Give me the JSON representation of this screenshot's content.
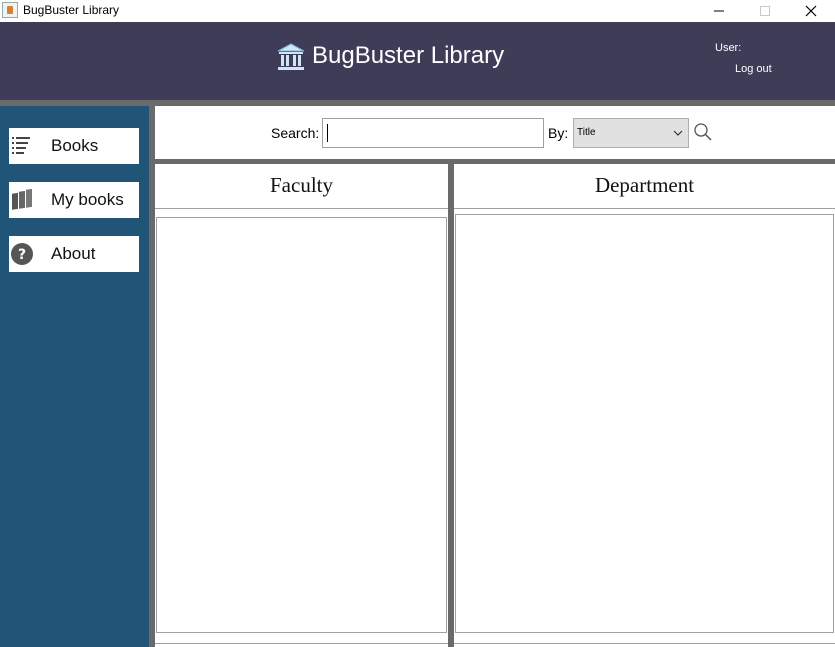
{
  "window": {
    "title": "BugBuster Library"
  },
  "header": {
    "title": "BugBuster Library",
    "user_label": "User:",
    "logout_label": "Log out",
    "background_color": "#3f3c57"
  },
  "sidebar": {
    "background_color": "#215577",
    "items": [
      {
        "label": "Books",
        "icon": "list-icon"
      },
      {
        "label": "My books",
        "icon": "books-stack-icon"
      },
      {
        "label": "About",
        "icon": "question-icon"
      }
    ]
  },
  "search": {
    "label": "Search:",
    "value": "",
    "by_label": "By:",
    "by_selected": "Title"
  },
  "panels": {
    "faculty": {
      "header": "Faculty",
      "items": []
    },
    "department": {
      "header": "Department",
      "items": []
    }
  }
}
